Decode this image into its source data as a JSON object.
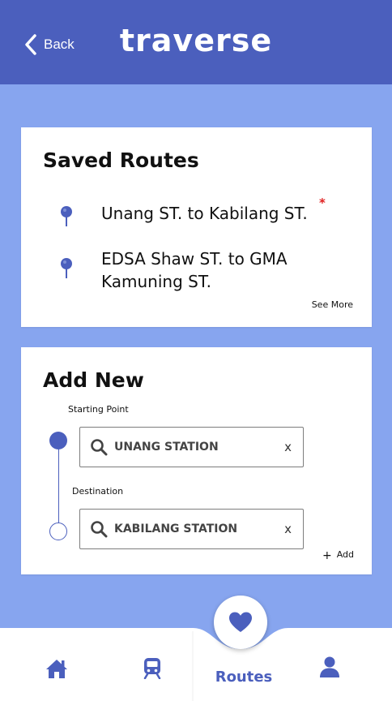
{
  "header": {
    "back_label": "Back",
    "logo_text": "traverse"
  },
  "saved_routes": {
    "title": "Saved Routes",
    "routes": [
      {
        "label": "Unang ST. to Kabilang ST.",
        "marker": "*"
      },
      {
        "label": "EDSA Shaw ST. to GMA Kamuning ST."
      }
    ],
    "see_more_label": "See More"
  },
  "add_new": {
    "title": "Add New",
    "starting_point_label": "Starting Point",
    "starting_point_value": "UNANG STATION",
    "destination_label": "Destination",
    "destination_value": "KABILANG STATION",
    "clear_label": "x",
    "add_plus": "+",
    "add_label": "Add"
  },
  "bottom_nav": {
    "active_label": "Routes",
    "items": [
      "home-icon",
      "train-icon",
      "heart-icon",
      "user-icon"
    ]
  },
  "colors": {
    "brand": "#4b5fbd",
    "background": "#87a5ef",
    "alert": "#e02020"
  }
}
